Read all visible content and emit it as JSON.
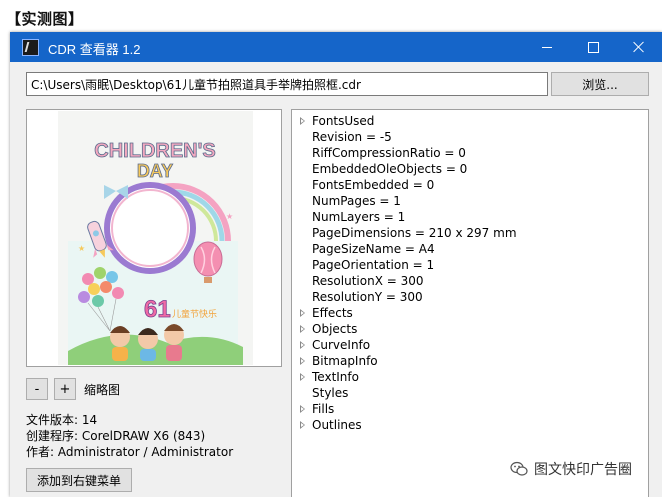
{
  "page_caption": "【实测图】",
  "window": {
    "title": "CDR 查看器 1.2",
    "icon": "coreldraw-app-icon"
  },
  "path_input": {
    "value": "C:\\Users\\雨眠\\Desktop\\61儿童节拍照道具手举牌拍照框.cdr"
  },
  "browse_button": {
    "label": "浏览..."
  },
  "preview": {
    "title_line1": "CHILDREN'S",
    "title_line2": "DAY",
    "badge_number": "61",
    "badge_text": "儿童节快乐"
  },
  "zoom": {
    "minus_label": "-",
    "plus_label": "+",
    "thumbnail_label": "缩略图"
  },
  "file_info": {
    "version": "文件版本: 14",
    "creator": "创建程序: CorelDRAW X6 (843)",
    "author": "作者: Administrator / Administrator"
  },
  "context_menu_button": {
    "label": "添加到右键菜单"
  },
  "tree": {
    "items": [
      {
        "text": "FontsUsed",
        "expandable": true
      },
      {
        "text": "Revision = -5",
        "expandable": false
      },
      {
        "text": "RiffCompressionRatio = 0",
        "expandable": false
      },
      {
        "text": "EmbeddedOleObjects = 0",
        "expandable": false
      },
      {
        "text": "FontsEmbedded = 0",
        "expandable": false
      },
      {
        "text": "NumPages = 1",
        "expandable": false
      },
      {
        "text": "NumLayers = 1",
        "expandable": false
      },
      {
        "text": "PageDimensions = 210 x 297 mm",
        "expandable": false
      },
      {
        "text": "PageSizeName = A4",
        "expandable": false
      },
      {
        "text": "PageOrientation = 1",
        "expandable": false
      },
      {
        "text": "ResolutionX = 300",
        "expandable": false
      },
      {
        "text": "ResolutionY = 300",
        "expandable": false
      },
      {
        "text": "Effects",
        "expandable": true
      },
      {
        "text": "Objects",
        "expandable": true
      },
      {
        "text": "CurveInfo",
        "expandable": true
      },
      {
        "text": "BitmapInfo",
        "expandable": true
      },
      {
        "text": "TextInfo",
        "expandable": true
      },
      {
        "text": "Styles",
        "expandable": false
      },
      {
        "text": "Fills",
        "expandable": true
      },
      {
        "text": "Outlines",
        "expandable": true
      }
    ]
  },
  "watermark": {
    "text": "图文快印广告圈",
    "icon": "wechat-icon"
  },
  "colors": {
    "titlebar": "#1565c9",
    "window_bg": "#f0f0f0"
  }
}
